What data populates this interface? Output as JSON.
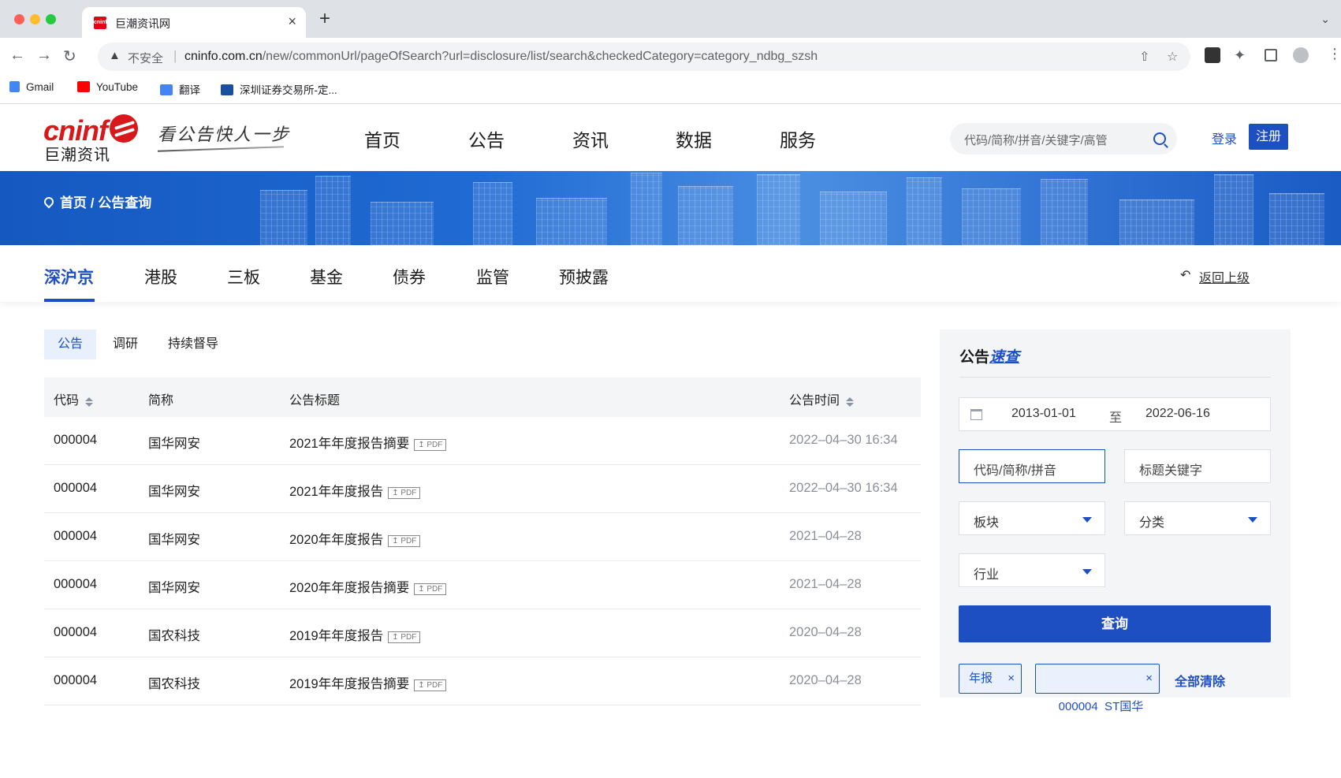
{
  "browser": {
    "tab_title": "巨潮资讯网",
    "tab_close": "×",
    "new_tab": "+",
    "insecure_label": "不安全",
    "url_host": "cninfo.com.cn",
    "url_path": "/new/commonUrl/pageOfSearch?url=disclosure/list/search&checkedCategory=category_ndbg_szsh",
    "bookmarks": [
      {
        "label": "Gmail",
        "color": "#4285f4"
      },
      {
        "label": "YouTube",
        "color": "#ff0000"
      },
      {
        "label": "翻译",
        "color": "#4285f4"
      },
      {
        "label": "深圳证券交易所-定...",
        "color": "#1a4fa0"
      }
    ]
  },
  "header": {
    "logo_en": "cninf",
    "logo_cn": "巨潮资讯",
    "slogan": "看公告快人一步",
    "nav": [
      "首页",
      "公告",
      "资讯",
      "数据",
      "服务"
    ],
    "search_placeholder": "代码/简称/拼音/关键字/高管",
    "login": "登录",
    "register": "注册"
  },
  "breadcrumb": {
    "home": "首页",
    "sep": "/",
    "current": "公告查询"
  },
  "market_tabs": [
    "深沪京",
    "港股",
    "三板",
    "基金",
    "债券",
    "监管",
    "预披露"
  ],
  "back_link": "返回上级",
  "sub_tabs": [
    "公告",
    "调研",
    "持续督导"
  ],
  "table": {
    "headers": {
      "code": "代码",
      "name": "简称",
      "title": "公告标题",
      "time": "公告时间"
    },
    "pdf_label": "PDF",
    "rows": [
      {
        "code": "000004",
        "name": "国华网安",
        "title": "2021年年度报告摘要",
        "time": "2022–04–30 16:34"
      },
      {
        "code": "000004",
        "name": "国华网安",
        "title": "2021年年度报告",
        "time": "2022–04–30 16:34"
      },
      {
        "code": "000004",
        "name": "国华网安",
        "title": "2020年年度报告",
        "time": "2021–04–28"
      },
      {
        "code": "000004",
        "name": "国华网安",
        "title": "2020年年度报告摘要",
        "time": "2021–04–28"
      },
      {
        "code": "000004",
        "name": "国农科技",
        "title": "2019年年度报告",
        "time": "2020–04–28"
      },
      {
        "code": "000004",
        "name": "国农科技",
        "title": "2019年年度报告摘要",
        "time": "2020–04–28"
      }
    ]
  },
  "quick_search": {
    "title_a": "公告",
    "title_b": "速查",
    "date_from": "2013-01-01",
    "date_to_label": "至",
    "date_to": "2022-06-16",
    "code_placeholder": "代码/简称/拼音",
    "keyword_placeholder": "标题关键字",
    "board": "板块",
    "category": "分类",
    "industry": "行业",
    "query_button": "查询",
    "chips": [
      "年报",
      "000004  ST国华"
    ],
    "chip_close": "×",
    "clear_all": "全部清除"
  }
}
